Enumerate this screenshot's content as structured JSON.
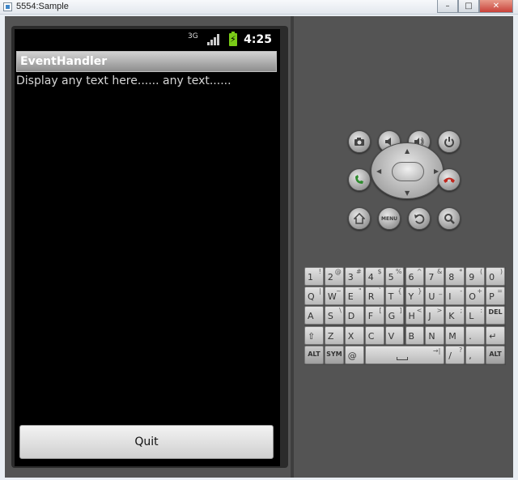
{
  "window": {
    "title": "5554:Sample"
  },
  "status_bar": {
    "time": "4:25",
    "network": "3G"
  },
  "app": {
    "title": "EventHandler",
    "body_text": "Display any text here...... any text......",
    "quit_label": "Quit"
  },
  "controls": {
    "menu_label": "MENU"
  },
  "keyboard": {
    "rows": [
      [
        {
          "m": "1",
          "s": "!"
        },
        {
          "m": "2",
          "s": "@"
        },
        {
          "m": "3",
          "s": "#"
        },
        {
          "m": "4",
          "s": "$"
        },
        {
          "m": "5",
          "s": "%"
        },
        {
          "m": "6",
          "s": "^"
        },
        {
          "m": "7",
          "s": "&"
        },
        {
          "m": "8",
          "s": "*"
        },
        {
          "m": "9",
          "s": "("
        },
        {
          "m": "0",
          "s": ")"
        }
      ],
      [
        {
          "m": "Q",
          "s": "|"
        },
        {
          "m": "W",
          "s": "~"
        },
        {
          "m": "E",
          "s": "\""
        },
        {
          "m": "R",
          "s": "`"
        },
        {
          "m": "T",
          "s": "{"
        },
        {
          "m": "Y",
          "s": "}"
        },
        {
          "m": "U",
          "s": "_"
        },
        {
          "m": "I",
          "s": "-"
        },
        {
          "m": "O",
          "s": "+"
        },
        {
          "m": "P",
          "s": "="
        }
      ],
      [
        {
          "m": "A",
          "s": ""
        },
        {
          "m": "S",
          "s": "\\"
        },
        {
          "m": "D",
          "s": ""
        },
        {
          "m": "F",
          "s": "["
        },
        {
          "m": "G",
          "s": "]"
        },
        {
          "m": "H",
          "s": "<"
        },
        {
          "m": "J",
          "s": ">"
        },
        {
          "m": "K",
          "s": ";"
        },
        {
          "m": "L",
          "s": ":"
        },
        {
          "m": "DEL",
          "s": ""
        }
      ],
      [
        {
          "m": "⇧",
          "s": ""
        },
        {
          "m": "Z",
          "s": ""
        },
        {
          "m": "X",
          "s": ""
        },
        {
          "m": "C",
          "s": ""
        },
        {
          "m": "V",
          "s": ""
        },
        {
          "m": "B",
          "s": ""
        },
        {
          "m": "N",
          "s": ""
        },
        {
          "m": "M",
          "s": ""
        },
        {
          "m": ".",
          "s": ""
        },
        {
          "m": "↵",
          "s": ""
        }
      ]
    ],
    "bottom": {
      "alt": "ALT",
      "sym": "SYM",
      "at": "@",
      "slash": "/",
      "question": "?",
      "comma": ",",
      "alt2": "ALT"
    }
  }
}
